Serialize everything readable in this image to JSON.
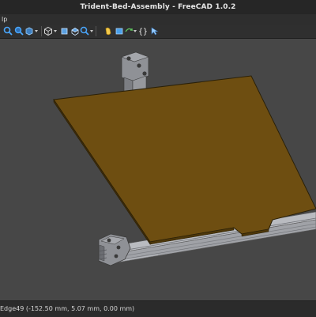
{
  "window": {
    "title": "Trident-Bed-Assembly - FreeCAD 1.0.2"
  },
  "menu": {
    "items": [
      {
        "label": "lp"
      }
    ]
  },
  "toolbar": {
    "icons": [
      "view-fit-all-icon",
      "view-fit-selection-icon",
      "draw-style-icon",
      "isometric-view-icon",
      "measure-icon",
      "link-icon",
      "part-icon",
      "macro-icon",
      "variable-set-icon",
      "whats-this-icon"
    ]
  },
  "viewport": {
    "background": "#474747",
    "heated_bed": {
      "color": "#6e4e11"
    },
    "extrusion": {
      "color": "#a9abb0"
    },
    "brackets": {
      "color": "#8f9196"
    }
  },
  "status": {
    "text": "Edge49 (-152.50 mm, 5.07 mm, 0.00 mm)"
  }
}
